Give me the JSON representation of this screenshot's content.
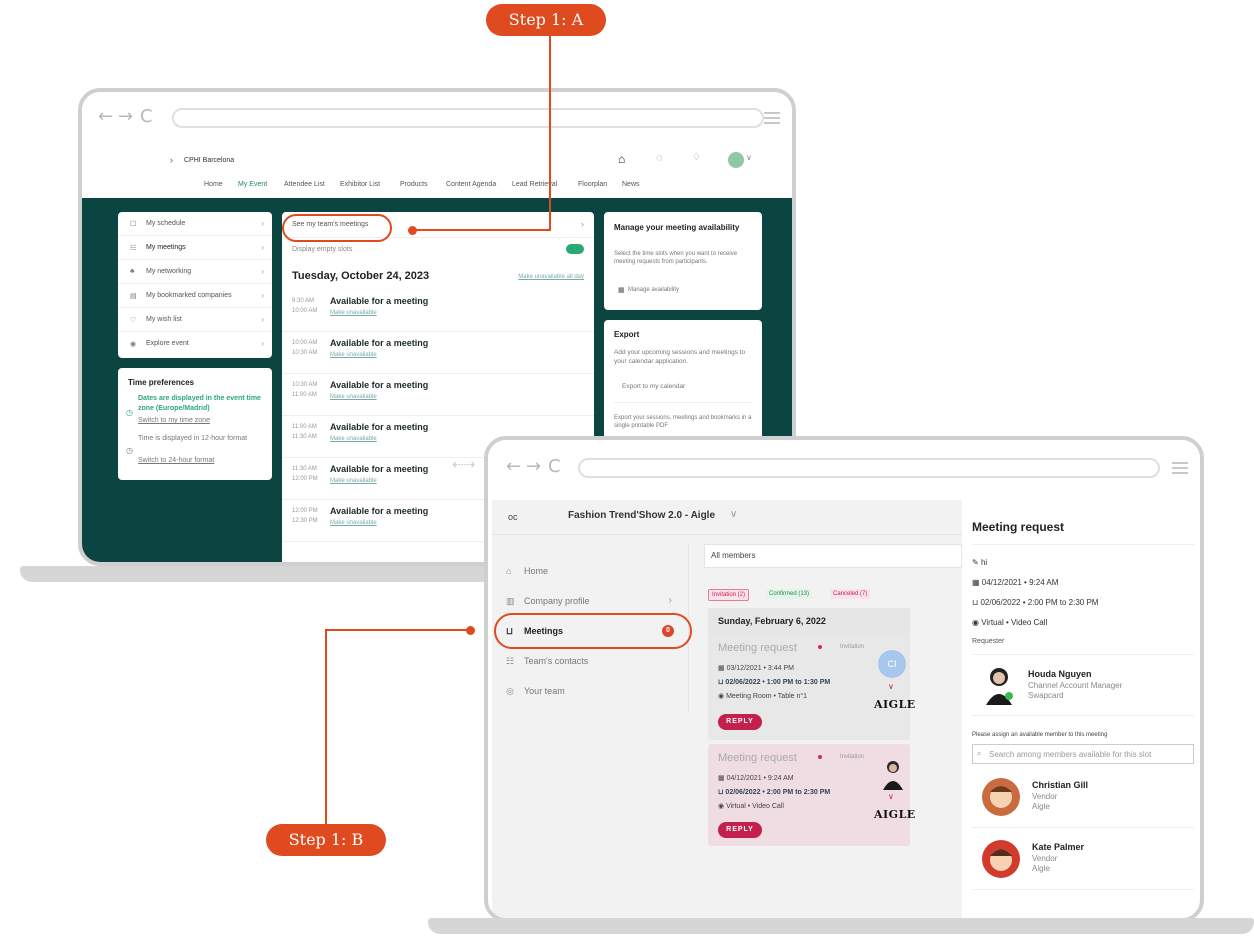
{
  "steps": {
    "a": "Step 1: A",
    "b": "Step 1: B"
  },
  "laptop1": {
    "breadcrumb": "CPHI Barcelona",
    "menu": [
      "Home",
      "My Event",
      "Attendee List",
      "Exhibitor List",
      "Products",
      "Content Agenda",
      "Lead Retrieval",
      "Floorplan",
      "News"
    ],
    "sidebar": [
      {
        "icon": "☐",
        "label": "My schedule"
      },
      {
        "icon": "☷",
        "label": "My meetings"
      },
      {
        "icon": "♣",
        "label": "My networking"
      },
      {
        "icon": "▤",
        "label": "My bookmarked companies"
      },
      {
        "icon": "♡",
        "label": "My wish list"
      },
      {
        "icon": "◉",
        "label": "Explore event"
      }
    ],
    "time_prefs": {
      "title": "Time preferences",
      "tz_note": "Dates are displayed in the event time zone (Europe/Madrid)",
      "tz_link": "Switch to my time zone",
      "fmt_note": "Time is displayed in 12-hour format",
      "fmt_link": "Switch to 24-hour format"
    },
    "center": {
      "team_link": "See my team's meetings",
      "display_empty": "Display empty slots",
      "date": "Tuesday, October 24, 2023",
      "make_all": "Make unavailable all day",
      "slots": [
        {
          "start": "9:30 AM",
          "end": "10:00 AM",
          "title": "Available for a meeting",
          "action": "Make unavailable"
        },
        {
          "start": "10:00 AM",
          "end": "10:30 AM",
          "title": "Available for a meeting",
          "action": "Make unavailable"
        },
        {
          "start": "10:30 AM",
          "end": "11:00 AM",
          "title": "Available for a meeting",
          "action": "Make unavailable"
        },
        {
          "start": "11:00 AM",
          "end": "11:30 AM",
          "title": "Available for a meeting",
          "action": "Make unavailable"
        },
        {
          "start": "11:30 AM",
          "end": "12:00 PM",
          "title": "Available for a meeting",
          "action": "Make unavailable"
        },
        {
          "start": "12:00 PM",
          "end": "12:30 PM",
          "title": "Available for a meeting",
          "action": "Make unavailable"
        }
      ]
    },
    "right": {
      "avail_title": "Manage your meeting availability",
      "avail_desc": "Select the time slots when you want to receive meeting requests from participants.",
      "avail_link": "Manage availability",
      "export_title": "Export",
      "export_desc": "Add your upcoming sessions and meetings to your calendar application.",
      "export_link": "Export to my calendar",
      "export_pdf": "Export your sessions, meetings and bookmarks in a single printable PDF"
    }
  },
  "laptop2": {
    "event_name": "Fashion Trend'Show 2.0 - Aigle",
    "nav": [
      {
        "icon": "⌂",
        "label": "Home"
      },
      {
        "icon": "▥",
        "label": "Company profile"
      },
      {
        "icon": "⊔",
        "label": "Meetings",
        "badge": "0"
      },
      {
        "icon": "☷",
        "label": "Team's contacts"
      },
      {
        "icon": "◎",
        "label": "Your team"
      }
    ],
    "members_filter": "All members",
    "tabs": {
      "invitation": "Invitation (2)",
      "confirmed": "Confirmed (13)",
      "canceled": "Canceled (7)"
    },
    "day": "Sunday, February 6, 2022",
    "meetings": [
      {
        "title": "Meeting request",
        "status": "Invitation",
        "sent": "03/12/2021 • 3:44 PM",
        "when": "02/06/2022 • 1:00 PM to 1:30 PM",
        "where": "Meeting Room • Table n°1",
        "reply": "REPLY",
        "avatar": "CI",
        "brand": "AIGLE"
      },
      {
        "title": "Meeting request",
        "status": "Invitation",
        "sent": "04/12/2021 • 9:24 AM",
        "when": "02/06/2022 • 2:00 PM to 2:30 PM",
        "where": "Virtual • Video Call",
        "reply": "REPLY",
        "brand": "AIGLE"
      }
    ],
    "detail": {
      "title": "Meeting request",
      "msg": "hi",
      "sent": "04/12/2021 • 9:24 AM",
      "when": "02/06/2022 • 2:00 PM to 2:30 PM",
      "where": "Virtual • Video Call",
      "requester_label": "Requester",
      "requester": {
        "name": "Houda Nguyen",
        "role": "Channel Account Manager",
        "company": "Swapcard"
      },
      "assign_label": "Please assign an available member to this meeting",
      "search_placeholder": "Search among members available for this slot",
      "members": [
        {
          "name": "Christian Gill",
          "role": "Vendor",
          "company": "Aigle"
        },
        {
          "name": "Kate Palmer",
          "role": "Vendor",
          "company": "Aigle"
        }
      ]
    }
  },
  "colors": {
    "accent": "#e04a1f",
    "teal": "#0a4541",
    "reply": "#c4204e"
  }
}
